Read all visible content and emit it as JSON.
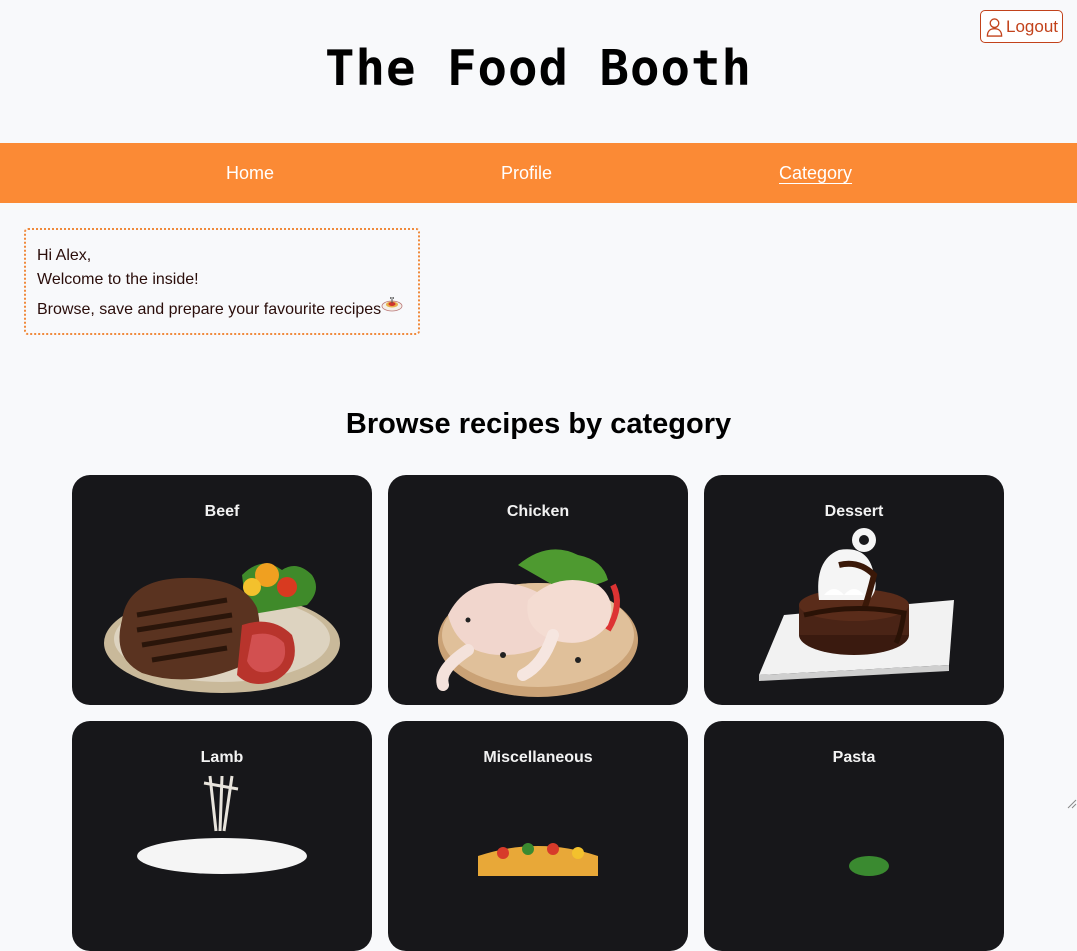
{
  "header": {
    "title": "The Food Booth",
    "logout_label": "Logout"
  },
  "nav": {
    "items": [
      {
        "label": "Home"
      },
      {
        "label": "Profile"
      },
      {
        "label": "Category"
      }
    ],
    "active": "Category"
  },
  "welcome": {
    "greeting": "Hi Alex,",
    "line2": "Welcome to the inside!",
    "line3": "Browse, save and prepare your favourite recipes"
  },
  "categories": {
    "heading": "Browse recipes by category",
    "items": [
      {
        "label": "Beef",
        "icon": "steak-image"
      },
      {
        "label": "Chicken",
        "icon": "chicken-image"
      },
      {
        "label": "Dessert",
        "icon": "dessert-image"
      },
      {
        "label": "Lamb",
        "icon": "lamb-image"
      },
      {
        "label": "Miscellaneous",
        "icon": "misc-image"
      },
      {
        "label": "Pasta",
        "icon": "pasta-image"
      }
    ]
  },
  "colors": {
    "accent": "#fb8a35",
    "logout": "#c2421b",
    "card_bg": "#17171a",
    "page_bg": "#f8f9fb"
  }
}
